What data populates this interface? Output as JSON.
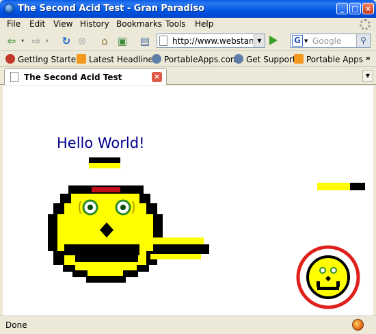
{
  "window": {
    "title": "The Second Acid Test - Gran Paradiso"
  },
  "menu": [
    {
      "label": "File",
      "name": "menu-file"
    },
    {
      "label": "Edit",
      "name": "menu-edit"
    },
    {
      "label": "View",
      "name": "menu-view"
    },
    {
      "label": "History",
      "name": "menu-history"
    },
    {
      "label": "Bookmarks",
      "name": "menu-bookmarks"
    },
    {
      "label": "Tools",
      "name": "menu-tools"
    },
    {
      "label": "Help",
      "name": "menu-help"
    }
  ],
  "navigation": {
    "url": "http://www.webstanda",
    "search_placeholder": "Google"
  },
  "bookmarks": [
    {
      "label": "Getting Started",
      "icon": "firefox-icon"
    },
    {
      "label": "Latest Headlines",
      "icon": "rss-icon"
    },
    {
      "label": "PortableApps.com",
      "icon": "portableapps-icon"
    },
    {
      "label": "Get Support",
      "icon": "portableapps-icon"
    },
    {
      "label": "Portable Apps",
      "icon": "rss-icon"
    }
  ],
  "tab": {
    "label": "The Second Acid Test"
  },
  "page": {
    "heading": "Hello World!"
  },
  "status": {
    "text": "Done"
  },
  "colors": {
    "smiley_yellow": "#ffff00",
    "ring_red": "#e0201a",
    "heading_blue": "#00008b",
    "titlebar_blue": "#0055e5"
  }
}
